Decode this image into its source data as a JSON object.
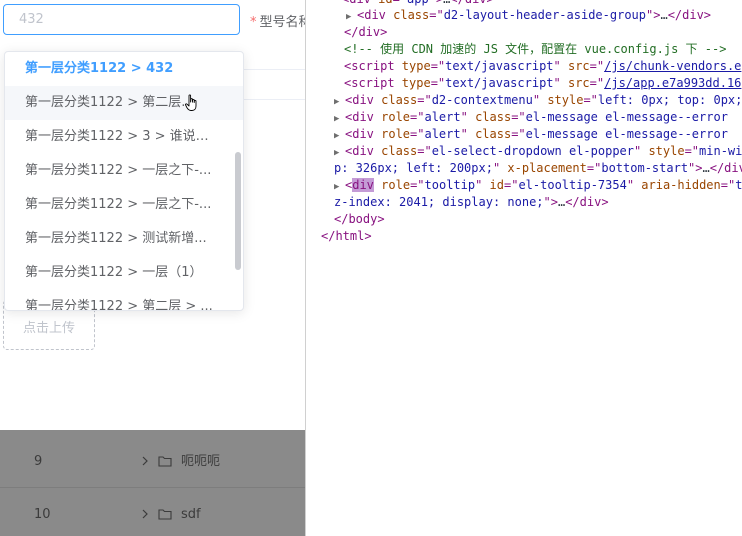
{
  "app": {
    "search": {
      "placeholder": "432",
      "value": ""
    },
    "field_label": {
      "required_mark": "*",
      "text": "型号名称"
    },
    "dropdown": {
      "items": [
        {
          "label": "第一层分类1122 > 432",
          "state": "selected"
        },
        {
          "label": "第一层分类1122 > 第二层...",
          "state": "hover"
        },
        {
          "label": "第一层分类1122 > 3 > 谁说的...",
          "state": "normal"
        },
        {
          "label": "第一层分类1122 > 一层之下-...",
          "state": "normal"
        },
        {
          "label": "第一层分类1122 > 一层之下-...",
          "state": "normal"
        },
        {
          "label": "第一层分类1122 > 测试新增...",
          "state": "normal"
        },
        {
          "label": "第一层分类1122 > 一层（1）",
          "state": "normal"
        },
        {
          "label": "第一层分类1122 > 第二层 > ...",
          "state": "normal"
        }
      ]
    },
    "upload": {
      "label": "点击上传"
    },
    "table": {
      "rows": [
        {
          "index": "9",
          "name": "呃呃呃"
        },
        {
          "index": "10",
          "name": "sdf"
        }
      ]
    }
  },
  "devtools": {
    "lines": [
      [
        {
          "t": "tag",
          "v": "<div "
        },
        {
          "t": "an",
          "v": "id"
        },
        {
          "t": "tag",
          "v": "=\""
        },
        {
          "t": "av",
          "v": "app"
        },
        {
          "t": "tag",
          "v": "\">"
        },
        {
          "t": "tx",
          "v": "…"
        },
        {
          "t": "tag",
          "v": "</div>"
        }
      ],
      [
        {
          "t": "tag",
          "v": "<div "
        },
        {
          "t": "an",
          "v": "class"
        },
        {
          "t": "tag",
          "v": "=\""
        },
        {
          "t": "av",
          "v": "d2-layout-header-aside-group"
        },
        {
          "t": "tag",
          "v": "\">"
        },
        {
          "t": "tx",
          "v": "…"
        },
        {
          "t": "tag",
          "v": "</div>"
        }
      ],
      [
        {
          "t": "tag",
          "v": "</div>"
        }
      ],
      [
        {
          "t": "cm",
          "v": "<!-- 使用 CDN 加速的 JS 文件，配置在 vue.config.js 下 -->"
        }
      ],
      [
        {
          "t": "tag",
          "v": "<script "
        },
        {
          "t": "an",
          "v": "type"
        },
        {
          "t": "tag",
          "v": "=\""
        },
        {
          "t": "av",
          "v": "text/javascript"
        },
        {
          "t": "tag",
          "v": "\" "
        },
        {
          "t": "an",
          "v": "src"
        },
        {
          "t": "tag",
          "v": "=\""
        },
        {
          "t": "lk",
          "v": "/js/chunk-vendors.e"
        }
      ],
      [
        {
          "t": "tag",
          "v": "<script "
        },
        {
          "t": "an",
          "v": "type"
        },
        {
          "t": "tag",
          "v": "=\""
        },
        {
          "t": "av",
          "v": "text/javascript"
        },
        {
          "t": "tag",
          "v": "\" "
        },
        {
          "t": "an",
          "v": "src"
        },
        {
          "t": "tag",
          "v": "=\""
        },
        {
          "t": "lk",
          "v": "/js/app.e7a993dd.16"
        }
      ],
      [
        {
          "t": "tag",
          "v": "<div "
        },
        {
          "t": "an",
          "v": "class"
        },
        {
          "t": "tag",
          "v": "=\""
        },
        {
          "t": "av",
          "v": "d2-contextmenu"
        },
        {
          "t": "tag",
          "v": "\" "
        },
        {
          "t": "an",
          "v": "style"
        },
        {
          "t": "tag",
          "v": "=\""
        },
        {
          "t": "av",
          "v": "left: 0px; top: 0px;"
        }
      ],
      [
        {
          "t": "tag",
          "v": "<div "
        },
        {
          "t": "an",
          "v": "role"
        },
        {
          "t": "tag",
          "v": "=\""
        },
        {
          "t": "av",
          "v": "alert"
        },
        {
          "t": "tag",
          "v": "\" "
        },
        {
          "t": "an",
          "v": "class"
        },
        {
          "t": "tag",
          "v": "=\""
        },
        {
          "t": "av",
          "v": "el-message el-message--error"
        }
      ],
      [
        {
          "t": "tag",
          "v": "<div "
        },
        {
          "t": "an",
          "v": "role"
        },
        {
          "t": "tag",
          "v": "=\""
        },
        {
          "t": "av",
          "v": "alert"
        },
        {
          "t": "tag",
          "v": "\" "
        },
        {
          "t": "an",
          "v": "class"
        },
        {
          "t": "tag",
          "v": "=\""
        },
        {
          "t": "av",
          "v": "el-message el-message--error"
        }
      ],
      [
        {
          "t": "tag",
          "v": "<div "
        },
        {
          "t": "an",
          "v": "class"
        },
        {
          "t": "tag",
          "v": "=\""
        },
        {
          "t": "av",
          "v": "el-select-dropdown el-popper"
        },
        {
          "t": "tag",
          "v": "\" "
        },
        {
          "t": "an",
          "v": "style"
        },
        {
          "t": "tag",
          "v": "=\""
        },
        {
          "t": "av",
          "v": "min-wi"
        }
      ],
      [
        {
          "t": "av",
          "v": "p: 326px; left: 200px;"
        },
        {
          "t": "tag",
          "v": "\" "
        },
        {
          "t": "an",
          "v": "x-placement"
        },
        {
          "t": "tag",
          "v": "=\""
        },
        {
          "t": "av",
          "v": "bottom-start"
        },
        {
          "t": "tag",
          "v": "\">"
        },
        {
          "t": "tx",
          "v": "…"
        },
        {
          "t": "tag",
          "v": "</div"
        }
      ],
      [
        {
          "t": "tag",
          "v": "<"
        },
        {
          "t": "hl",
          "v": "div"
        },
        {
          "t": "tag",
          "v": " "
        },
        {
          "t": "an",
          "v": "role"
        },
        {
          "t": "tag",
          "v": "=\""
        },
        {
          "t": "av",
          "v": "tooltip"
        },
        {
          "t": "tag",
          "v": "\" "
        },
        {
          "t": "an",
          "v": "id"
        },
        {
          "t": "tag",
          "v": "=\""
        },
        {
          "t": "av",
          "v": "el-tooltip-7354"
        },
        {
          "t": "tag",
          "v": "\" "
        },
        {
          "t": "an",
          "v": "aria-hidden"
        },
        {
          "t": "tag",
          "v": "=\""
        },
        {
          "t": "av",
          "v": "t"
        }
      ],
      [
        {
          "t": "av",
          "v": "z-index: 2041; display: none;"
        },
        {
          "t": "tag",
          "v": "\">"
        },
        {
          "t": "tx",
          "v": "…"
        },
        {
          "t": "tag",
          "v": "</div>"
        }
      ],
      [
        {
          "t": "tag",
          "v": "</body>"
        }
      ],
      [
        {
          "t": "tag",
          "v": "</html>"
        }
      ]
    ]
  }
}
